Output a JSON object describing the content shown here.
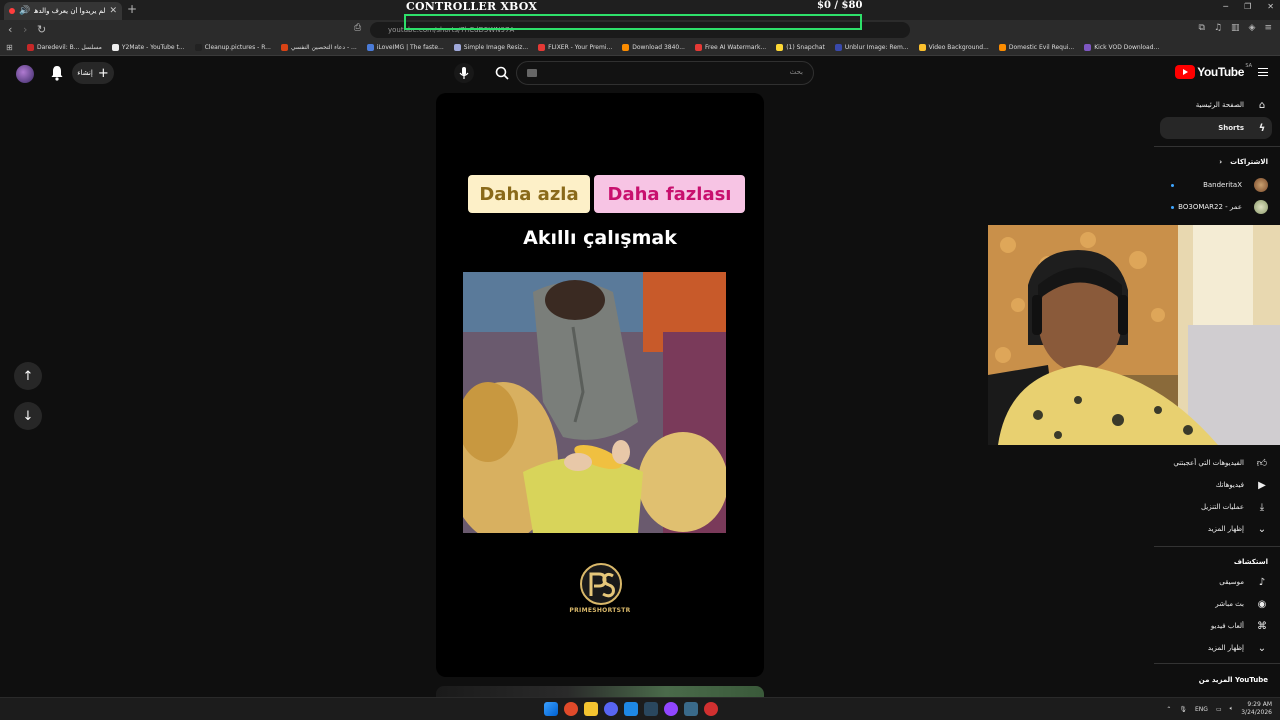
{
  "browser": {
    "tab_title": "لم يريدوا أن يعرف والدهم أن ...",
    "url": "youtube.com/shorts/7hCdD5WN97A",
    "bookmarks": [
      {
        "label": "Daredevil: B... مسلسل",
        "color": "#c62828"
      },
      {
        "label": "Y2Mate - YouTube t...",
        "color": "#eeeeee"
      },
      {
        "label": "Cleanup.pictures - R...",
        "color": "#222222"
      },
      {
        "label": "دعاء التحصين النفسي - ...",
        "color": "#d84315"
      },
      {
        "label": "iLoveIMG | The faste...",
        "color": "#4a7bd8"
      },
      {
        "label": "Simple Image Resiz...",
        "color": "#9fa8da"
      },
      {
        "label": "FLIXER - Your Premi...",
        "color": "#e53935"
      },
      {
        "label": "Download 3840...",
        "color": "#fb8c00"
      },
      {
        "label": "Free AI Watermark...",
        "color": "#e53935"
      },
      {
        "label": "(1) Snapchat",
        "color": "#fdd835"
      },
      {
        "label": "Unblur Image: Rem...",
        "color": "#3949ab"
      },
      {
        "label": "Video Background...",
        "color": "#fbc02d"
      },
      {
        "label": "Domestic Evil Requi...",
        "color": "#fb8c00"
      },
      {
        "label": "Kick VOD Download...",
        "color": "#7e57c2"
      }
    ]
  },
  "overlay": {
    "title": "CONTROLLER XBOX",
    "goal": "$0  / $80",
    "progress": 0,
    "bar_color": "#2ee06a"
  },
  "youtube": {
    "create_label": "إنشاء",
    "search_placeholder": "بحث",
    "logo_text": "YouTube",
    "country_code": "SA",
    "short": {
      "pill_left": "Daha azla",
      "pill_right": "Daha fazlası",
      "caption": "Akıllı çalışmak",
      "brand": "PRIMESHORTSTR"
    },
    "sidebar": {
      "home": "الصفحة الرئيسية",
      "shorts": "Shorts",
      "subscriptions": "الاشتراكات",
      "channels": [
        "BanderitaX",
        "BO3OMAR22 - عمر"
      ],
      "you_items": [
        "الفيديوهات التي أعجبتني",
        "فيديوهاتك",
        "عمليات التنزيل",
        "إظهار المزيد"
      ],
      "explore_heading": "استكشاف",
      "explore_items": [
        "موسيقى",
        "بث مباشر",
        "ألعاب فيديو",
        "إظهار المزيد"
      ],
      "more_from": "المزيد من YouTube"
    }
  },
  "taskbar": {
    "lang": "ENG",
    "time": "9:29 AM",
    "date": "3/24/2026"
  }
}
